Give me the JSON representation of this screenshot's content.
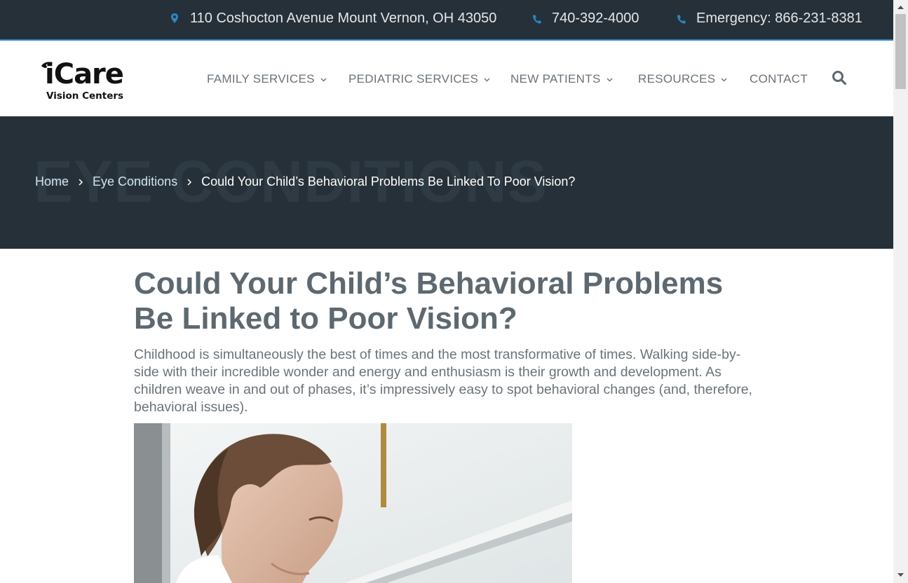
{
  "topbar": {
    "address": "110 Coshocton Avenue Mount Vernon, OH 43050",
    "phone": "740-392-4000",
    "emergency": "Emergency: 866-231-8381",
    "icon_color": "#2b86c5"
  },
  "logo": {
    "brand": "iCare",
    "subtitle": "Vision Centers"
  },
  "nav": {
    "items": [
      {
        "label": "FAMILY SERVICES",
        "has_dropdown": true
      },
      {
        "label": "PEDIATRIC SERVICES",
        "has_dropdown": true
      },
      {
        "label": "NEW PATIENTS",
        "has_dropdown": true
      },
      {
        "label": "RESOURCES",
        "has_dropdown": true
      },
      {
        "label": "CONTACT",
        "has_dropdown": false
      }
    ],
    "search_icon": "search-icon"
  },
  "hero": {
    "ghost_text": "EYE CONDITIONS",
    "breadcrumb": {
      "home": "Home",
      "category": "Eye Conditions",
      "current": "Could Your Child’s Behavioral Problems Be Linked To Poor Vision?"
    }
  },
  "article": {
    "title": "Could Your Child’s Behavioral Problems Be Linked to Poor Vision?",
    "intro": "Childhood is simultaneously the best of times and the most transformative of times. Walking side-by-side with their incredible wonder and energy and enthusiasm is their growth and development. As children weave in and out of phases, it’s impressively easy to spot behavioral changes (and, therefore, behavioral issues)."
  },
  "colors": {
    "dark_bg": "#263038",
    "accent": "#2b86c5",
    "heading": "#5d6870",
    "body_text": "#6a737a"
  }
}
